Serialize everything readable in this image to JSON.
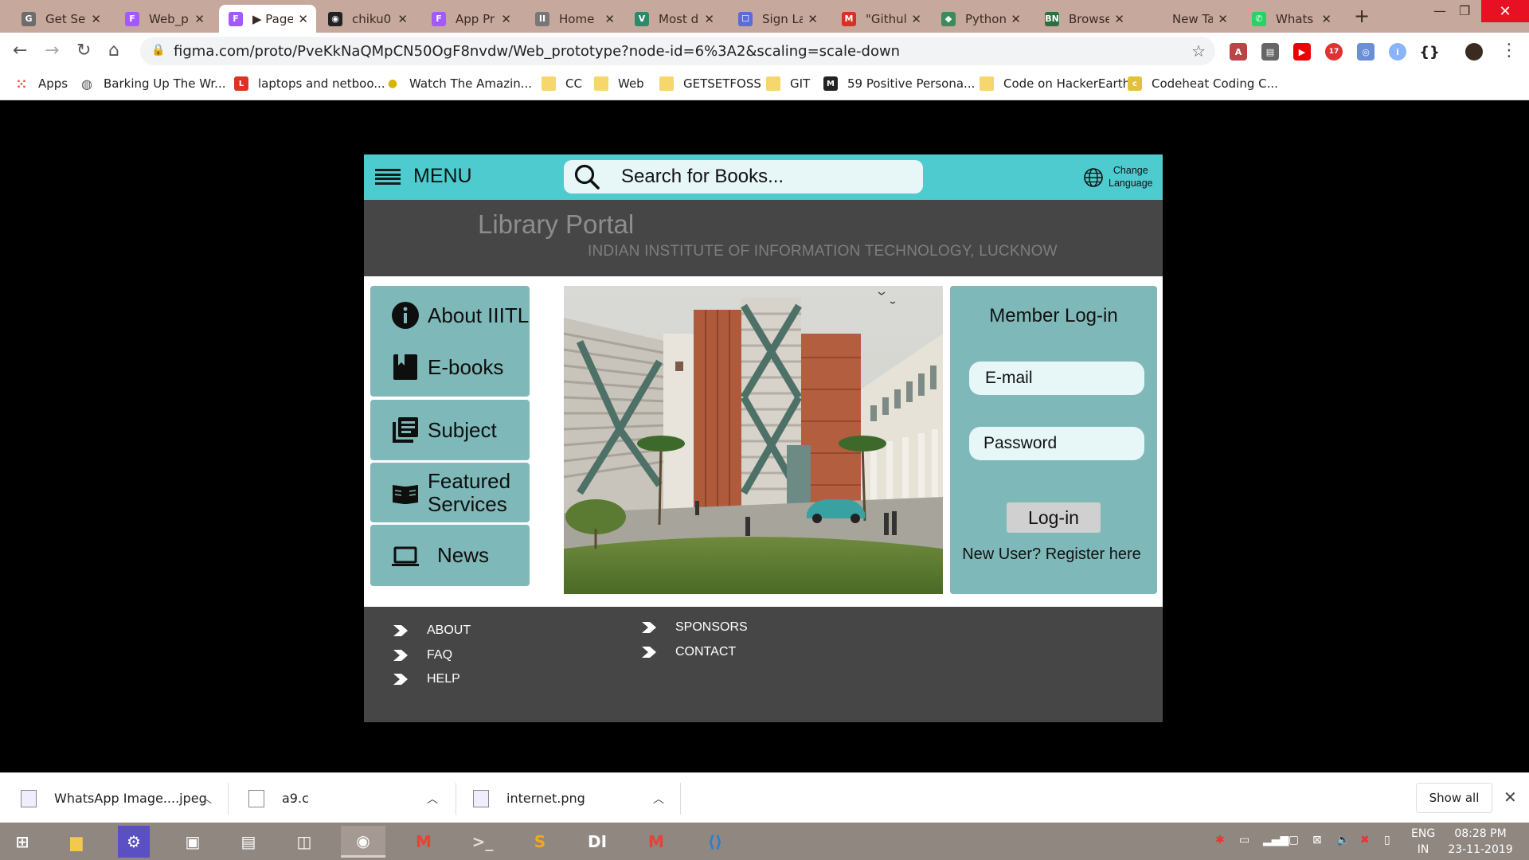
{
  "browser": {
    "tabs": [
      {
        "title": "Get Set",
        "fav": "G",
        "color": "#6c6c6c"
      },
      {
        "title": "Web_p",
        "fav": "F",
        "color": "#a259ff"
      },
      {
        "title": "▶ Page",
        "fav": "F",
        "color": "#a259ff",
        "active": true
      },
      {
        "title": "chiku0",
        "fav": "◉",
        "color": "#222222"
      },
      {
        "title": "App Pr",
        "fav": "F",
        "color": "#a259ff"
      },
      {
        "title": "Home |",
        "fav": "II",
        "color": "#777777"
      },
      {
        "title": "Most d",
        "fav": "V",
        "color": "#2c8a6b"
      },
      {
        "title": "Sign La",
        "fav": "☐",
        "color": "#5b6cd8"
      },
      {
        "title": "\"Githul",
        "fav": "M",
        "color": "#d93025"
      },
      {
        "title": "Python",
        "fav": "◆",
        "color": "#3d8a5a"
      },
      {
        "title": "Browse",
        "fav": "BN",
        "color": "#2c6e3f"
      },
      {
        "title": "New Tab",
        "fav": "",
        "color": "transparent"
      },
      {
        "title": "Whats",
        "fav": "✆",
        "color": "#25d366"
      }
    ],
    "url": "figma.com/proto/PveKkNaQMpCN50OgF8nvdw/Web_prototype?node-id=6%3A2&scaling=scale-down",
    "extension_badge": "17",
    "bookmarks": [
      {
        "label": "Apps",
        "icon": "apps-grid-icon"
      },
      {
        "label": "Barking Up The Wr...",
        "icon": "globe-icon"
      },
      {
        "label": "laptops and netboo...",
        "icon": "L"
      },
      {
        "label": "Watch The Amazin...",
        "icon": "bee"
      },
      {
        "label": "CC",
        "icon": "folder"
      },
      {
        "label": "Web",
        "icon": "folder"
      },
      {
        "label": "GETSETFOSS",
        "icon": "folder"
      },
      {
        "label": "GIT",
        "icon": "folder"
      },
      {
        "label": "59 Positive Persona...",
        "icon": "M"
      },
      {
        "label": "Code on HackerEarth",
        "icon": "folder"
      },
      {
        "label": "Codeheat Coding C...",
        "icon": "code"
      }
    ]
  },
  "site": {
    "menu_label": "MENU",
    "search_placeholder": "Search for Books...",
    "language_line1": "Change",
    "language_line2": "Language",
    "portal_title": "Library Portal",
    "portal_subtitle": "INDIAN INSTITUTE OF INFORMATION TECHNOLOGY, LUCKNOW",
    "sidebar": [
      {
        "label": "About IIITL",
        "icon": "info-icon"
      },
      {
        "label": "E-books",
        "icon": "book-icon"
      },
      {
        "label": "Subject",
        "icon": "library-books-icon"
      },
      {
        "label": "Featured\nServices",
        "icon": "open-book-icon"
      },
      {
        "label": "News",
        "icon": "laptop-icon"
      }
    ],
    "login": {
      "title": "Member Log-in",
      "email_placeholder": "E-mail",
      "password_placeholder": "Password",
      "button": "Log-in",
      "register_text": "New User? Register here"
    },
    "footer_col1": [
      "ABOUT",
      "FAQ",
      "HELP"
    ],
    "footer_col2": [
      "SPONSORS",
      "CONTACT"
    ]
  },
  "downloads": {
    "items": [
      "WhatsApp Image....jpeg",
      "a9.c",
      "internet.png"
    ],
    "show_all": "Show all"
  },
  "taskbar": {
    "lang_line1": "ENG",
    "lang_line2": "IN",
    "time": "08:28 PM",
    "date": "23-11-2019"
  },
  "colors": {
    "teal_header": "#4ecbcf",
    "panel_teal": "#7fb8b8",
    "dark_gray": "#464646"
  }
}
